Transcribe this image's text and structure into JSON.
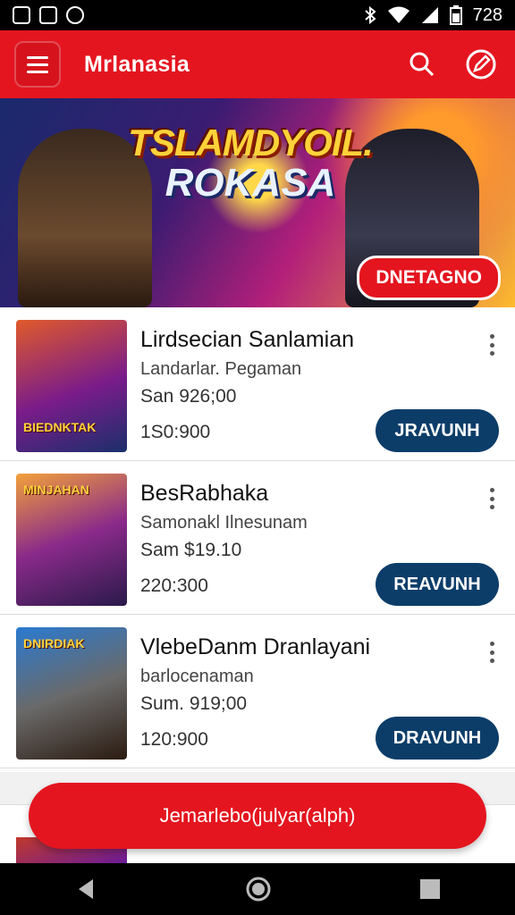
{
  "status_bar": {
    "time": "728"
  },
  "app": {
    "title": "Mrlanasia"
  },
  "banner": {
    "title_line1": "TSLAMDYOIL.",
    "title_line2": "ROKASA",
    "cta": "DNETAGNO"
  },
  "games": [
    {
      "thumb_label": "BIEDNKTAK",
      "title": "Lirdsecian Sanlamian",
      "subtitle": "Landarlar. Pegaman",
      "price": "San 926;00",
      "count": "1S0:900",
      "action": "JRAVUNH"
    },
    {
      "thumb_label": "MINJAHAN",
      "title": "BesRabhaka",
      "subtitle": "Samonakl Ilnesunam",
      "price": "Sam $19.10",
      "count": "220:300",
      "action": "REAVUNH"
    },
    {
      "thumb_label": "DNIRDIAK",
      "title": "VlebeDanm Dranlayani",
      "subtitle": "barlocenaman",
      "price": "Sum. 919;00",
      "count": "120:900",
      "action": "DRAVUNH"
    }
  ],
  "fab": {
    "label": "Jemarlebo(julyar(alph)"
  },
  "colors": {
    "primary": "#e4151f",
    "action": "#0c3d69"
  }
}
